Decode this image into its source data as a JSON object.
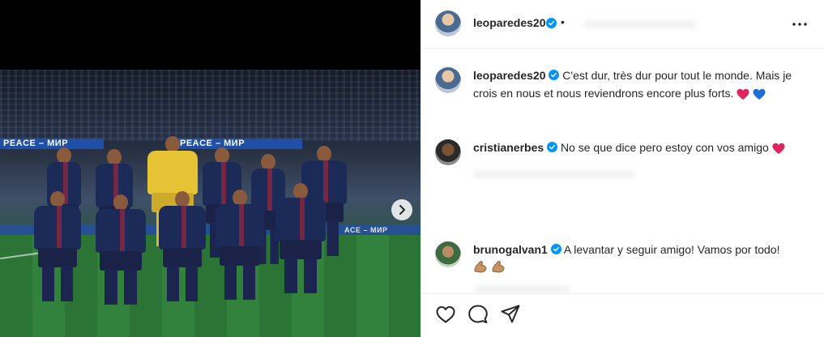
{
  "post": {
    "username": "leoparedes20",
    "separator": "•",
    "caption": "C'est dur, très dur pour tout le monde. Mais je crois en nous et nous reviendrons encore plus forts."
  },
  "media": {
    "ad_board_text": "PEACE – МИР",
    "ad_board_text_small": "ACE – МИР"
  },
  "comments": [
    {
      "username": "cristianerbes",
      "text": "No se que dice pero estoy con vos amigo"
    },
    {
      "username": "brunogalvan1",
      "text": "A levantar y seguir amigo! Vamos por todo!"
    }
  ],
  "colors": {
    "verified": "#0095f6",
    "heart_red": "#e0245e",
    "heart_blue": "#1d6fd6",
    "text": "#262626"
  },
  "icons": {
    "like": "heart-outline-icon",
    "comment": "speech-bubble-icon",
    "share": "paper-plane-icon",
    "more": "three-dots-icon",
    "next": "chevron-right-icon"
  }
}
